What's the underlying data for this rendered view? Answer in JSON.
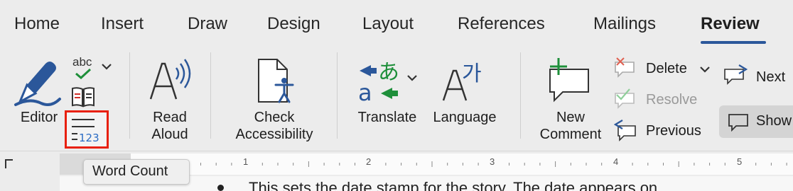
{
  "tabs": [
    {
      "label": "Home"
    },
    {
      "label": "Insert"
    },
    {
      "label": "Draw"
    },
    {
      "label": "Design"
    },
    {
      "label": "Layout"
    },
    {
      "label": "References"
    },
    {
      "label": "Mailings"
    },
    {
      "label": "Review"
    }
  ],
  "active_tab": "Review",
  "ribbon": {
    "editor": {
      "label": "Editor",
      "icon": "editor-pen-icon"
    },
    "spelling": {
      "label": "abc",
      "icon": "spelling-check-icon"
    },
    "thesaurus": {
      "icon": "thesaurus-book-icon"
    },
    "word_count": {
      "icon": "word-count-icon",
      "tooltip": "Word Count"
    },
    "read_aloud": {
      "label_line1": "Read",
      "label_line2": "Aloud",
      "icon": "read-aloud-icon"
    },
    "check_accessibility": {
      "label_line1": "Check",
      "label_line2": "Accessibility",
      "icon": "accessibility-icon"
    },
    "translate": {
      "label": "Translate",
      "icon": "translate-icon"
    },
    "language": {
      "label": "Language",
      "icon": "language-icon"
    },
    "new_comment": {
      "label_line1": "New",
      "label_line2": "Comment",
      "icon": "new-comment-icon"
    },
    "delete": {
      "label": "Delete",
      "icon": "delete-comment-icon"
    },
    "resolve": {
      "label": "Resolve",
      "icon": "resolve-comment-icon"
    },
    "previous": {
      "label": "Previous",
      "icon": "previous-comment-icon"
    },
    "next": {
      "label": "Next",
      "icon": "next-comment-icon"
    },
    "show": {
      "label": "Show",
      "icon": "show-comments-icon"
    }
  },
  "ruler": {
    "numbers": [
      "1",
      "2",
      "3",
      "4",
      "5"
    ]
  },
  "document": {
    "text": "This sets the date stamp for the story. The date appears on"
  },
  "colors": {
    "accent": "#2b579a",
    "highlight": "#e8200d",
    "green": "#1e8f3a"
  }
}
